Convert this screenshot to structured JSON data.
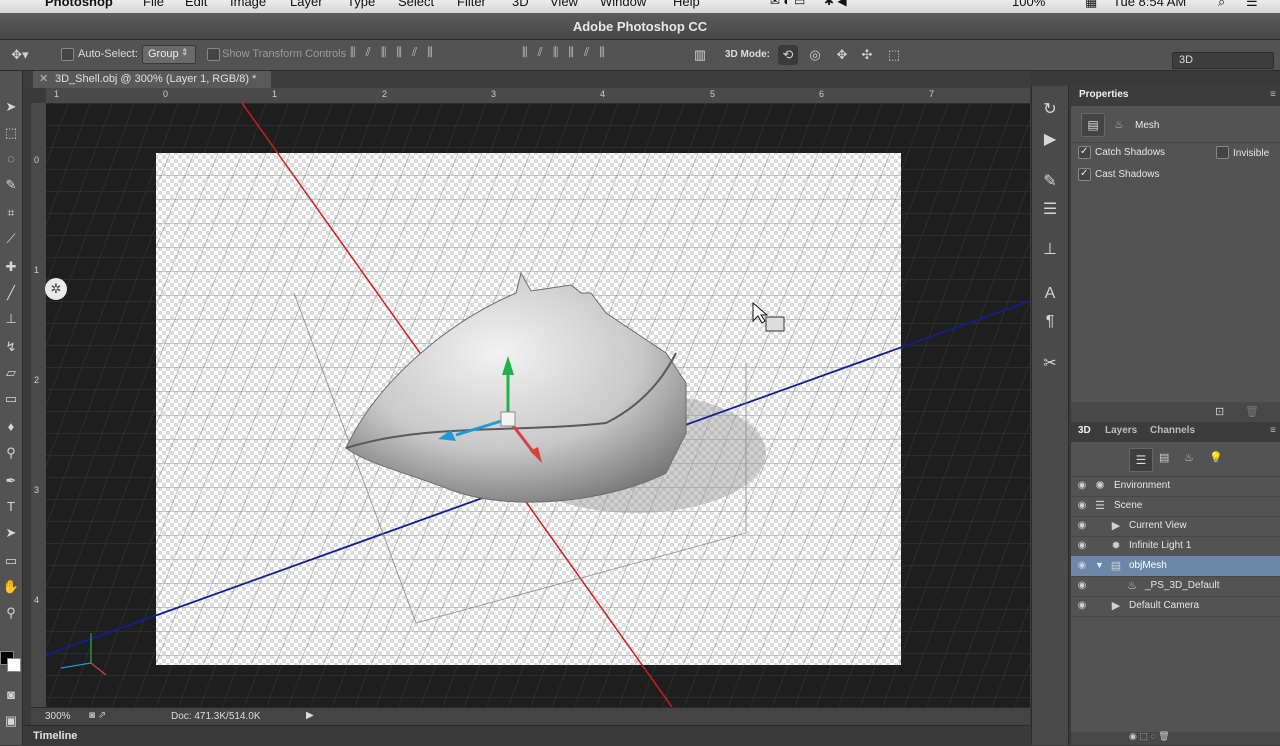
{
  "mac_menu": {
    "app": "Photoshop",
    "items": [
      "File",
      "Edit",
      "Image",
      "Layer",
      "Type",
      "Select",
      "Filter",
      "3D",
      "View",
      "Window",
      "Help"
    ],
    "battery": "100%",
    "clock": "Tue 8:54 AM"
  },
  "window": {
    "title": "Adobe Photoshop CC"
  },
  "options_bar": {
    "auto_select_label": "Auto-Select:",
    "auto_select_value": "Group",
    "show_transform_label": "Show Transform Controls",
    "mode_3d_label": "3D Mode:",
    "workspace_value": "3D"
  },
  "document": {
    "tab_title": "3D_Shell.obj @ 300% (Layer 1, RGB/8) *",
    "ruler_top": [
      "1",
      "0",
      "1",
      "2",
      "3",
      "4",
      "5",
      "6",
      "7"
    ],
    "ruler_left": [
      "0",
      "1",
      "2",
      "3",
      "4"
    ]
  },
  "status": {
    "zoom": "300%",
    "doc_info": "Doc: 471.3K/514.0K"
  },
  "timeline": {
    "label": "Timeline"
  },
  "properties": {
    "tab": "Properties",
    "section_label": "Mesh",
    "catch_shadows": "Catch Shadows",
    "cast_shadows": "Cast Shadows",
    "invisible": "Invisible",
    "catch_checked": true,
    "cast_checked": true,
    "invisible_checked": false
  },
  "layers_panel": {
    "tabs": [
      "3D",
      "Layers",
      "Channels"
    ],
    "rows": [
      {
        "label": "Environment",
        "icon": "environment-icon"
      },
      {
        "label": "Scene",
        "icon": "scene-icon"
      },
      {
        "label": "Current View",
        "icon": "camera-icon"
      },
      {
        "label": "Infinite Light 1",
        "icon": "light-icon"
      },
      {
        "label": "objMesh",
        "icon": "mesh-icon"
      },
      {
        "label": "_PS_3D_Default",
        "icon": "material-icon"
      },
      {
        "label": "Default Camera",
        "icon": "camera-icon"
      }
    ]
  },
  "colors": {
    "ui_dark": "#535353",
    "selected_row": "#6c87a7",
    "x_axis": "#cc1f1f",
    "z_axis": "#101f8f",
    "gizmo_green": "#22b24a",
    "gizmo_blue": "#1f9ad8",
    "gizmo_red": "#d84040"
  }
}
